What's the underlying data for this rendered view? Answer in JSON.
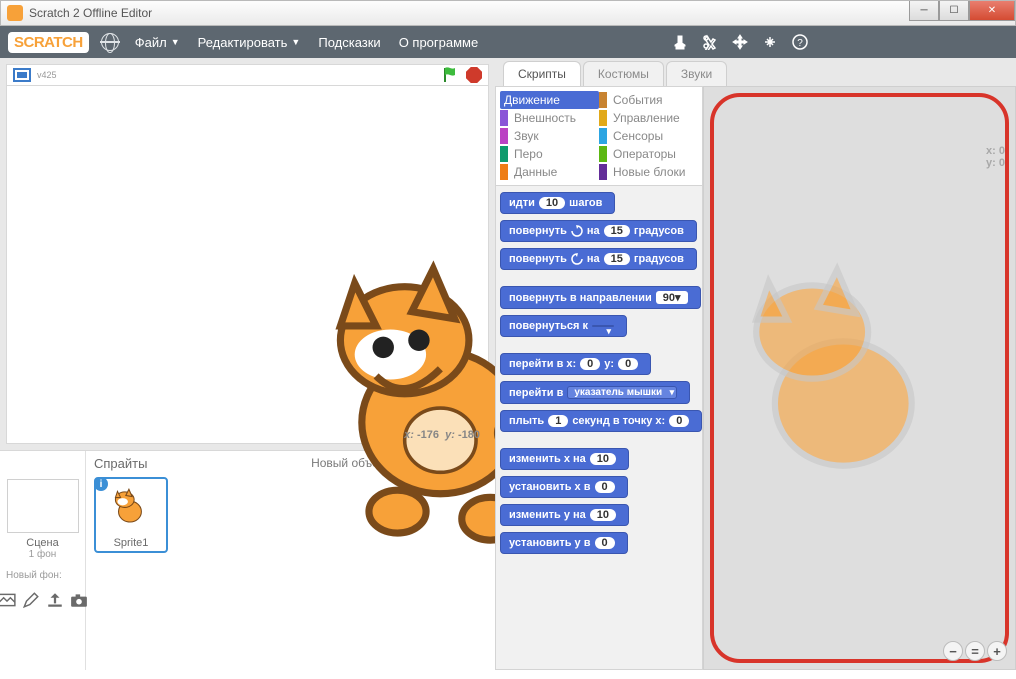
{
  "window": {
    "title": "Scratch 2 Offline Editor"
  },
  "logo": "SCRATCH",
  "menu": {
    "file": "Файл",
    "edit": "Редактировать",
    "tips": "Подсказки",
    "about": "О программе"
  },
  "stage": {
    "version": "v425",
    "xlabel": "x:",
    "xval": "-176",
    "ylabel": "y:",
    "yval": "-180"
  },
  "spritePanel": {
    "spritesTitle": "Спрайты",
    "newObject": "Новый объект:",
    "stageLabel": "Сцена",
    "backdropsCount": "1 фон",
    "newBackdrop": "Новый фон:",
    "spriteName": "Sprite1"
  },
  "tabs": {
    "scripts": "Скрипты",
    "costumes": "Костюмы",
    "sounds": "Звуки"
  },
  "categories": {
    "motion": "Движение",
    "looks": "Внешность",
    "sound": "Звук",
    "pen": "Перо",
    "data": "Данные",
    "events": "События",
    "control": "Управление",
    "sensing": "Сенсоры",
    "operators": "Операторы",
    "more": "Новые блоки"
  },
  "blocks": {
    "move1": "идти",
    "move_val": "10",
    "move2": "шагов",
    "turncw1": "повернуть",
    "turncw_val": "15",
    "turncw2": "градусов",
    "turnccw1": "повернуть",
    "turnccw_val": "15",
    "turnccw2": "градусов",
    "point1": "повернуть в направлении",
    "point_val": "90▾",
    "pointto1": "повернуться к",
    "pointto_dd": " ",
    "gotoxy1": "перейти в x:",
    "gotoxy_x": "0",
    "gotoxy2": "y:",
    "gotoxy_y": "0",
    "goto1": "перейти в",
    "goto_dd": "указатель мышки",
    "glide1": "плыть",
    "glide_s": "1",
    "glide2": "секунд в точку x:",
    "glide_x": "0",
    "changex1": "изменить x на",
    "changex_v": "10",
    "setx1": "установить x в",
    "setx_v": "0",
    "changey1": "изменить y на",
    "changey_v": "10",
    "sety1": "установить y в",
    "sety_v": "0"
  },
  "scriptArea": {
    "x": "x: 0",
    "y": "y: 0"
  },
  "colors": {
    "motion": "#4a6cd4",
    "looks": "#8a55d7",
    "sound": "#bb42c3",
    "pen": "#0e9a6c",
    "data": "#ee7d16",
    "events": "#c88330",
    "control": "#e1a91a",
    "sensing": "#2ca5e2",
    "operators": "#5cb712",
    "more": "#632d99"
  }
}
